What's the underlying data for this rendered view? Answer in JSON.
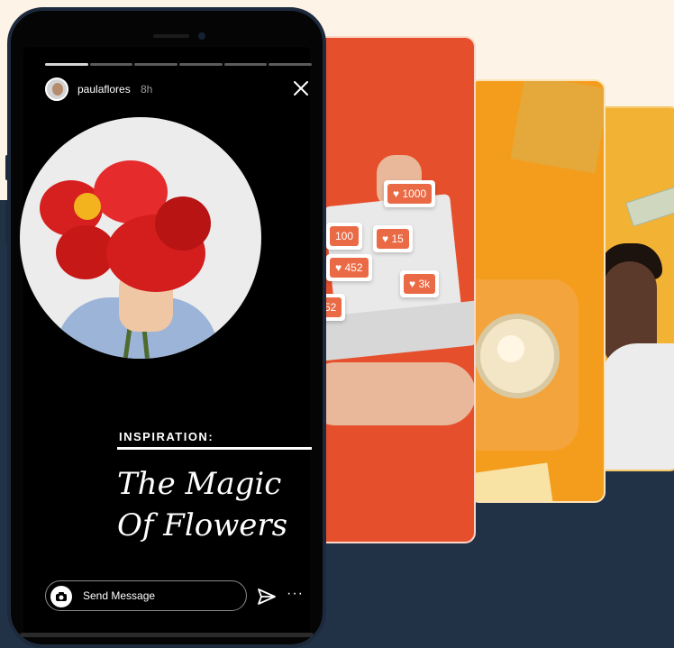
{
  "story": {
    "username": "paulaflores",
    "time_ago": "8h",
    "category": "INSPIRATION:",
    "title_line1": "The Magic",
    "title_line2": "Of Flowers",
    "message_placeholder": "Send Message",
    "more_label": "···",
    "progress_segments": 6,
    "active_segment": 1
  },
  "notifications": [
    {
      "value": "1000"
    },
    {
      "value": "100"
    },
    {
      "value": "15"
    },
    {
      "value": "452"
    },
    {
      "value": "3k"
    },
    {
      "value": "52"
    }
  ],
  "colors": {
    "top_background": "#fdf3e7",
    "bottom_background": "#223246",
    "card_orange_red": "#e64f2b",
    "card_orange": "#f49d1d",
    "card_yellow": "#f2b233",
    "notification": "#ea6a45"
  },
  "icons": {
    "close": "close-icon",
    "camera": "camera-icon",
    "send": "send-icon",
    "heart": "heart-icon"
  }
}
